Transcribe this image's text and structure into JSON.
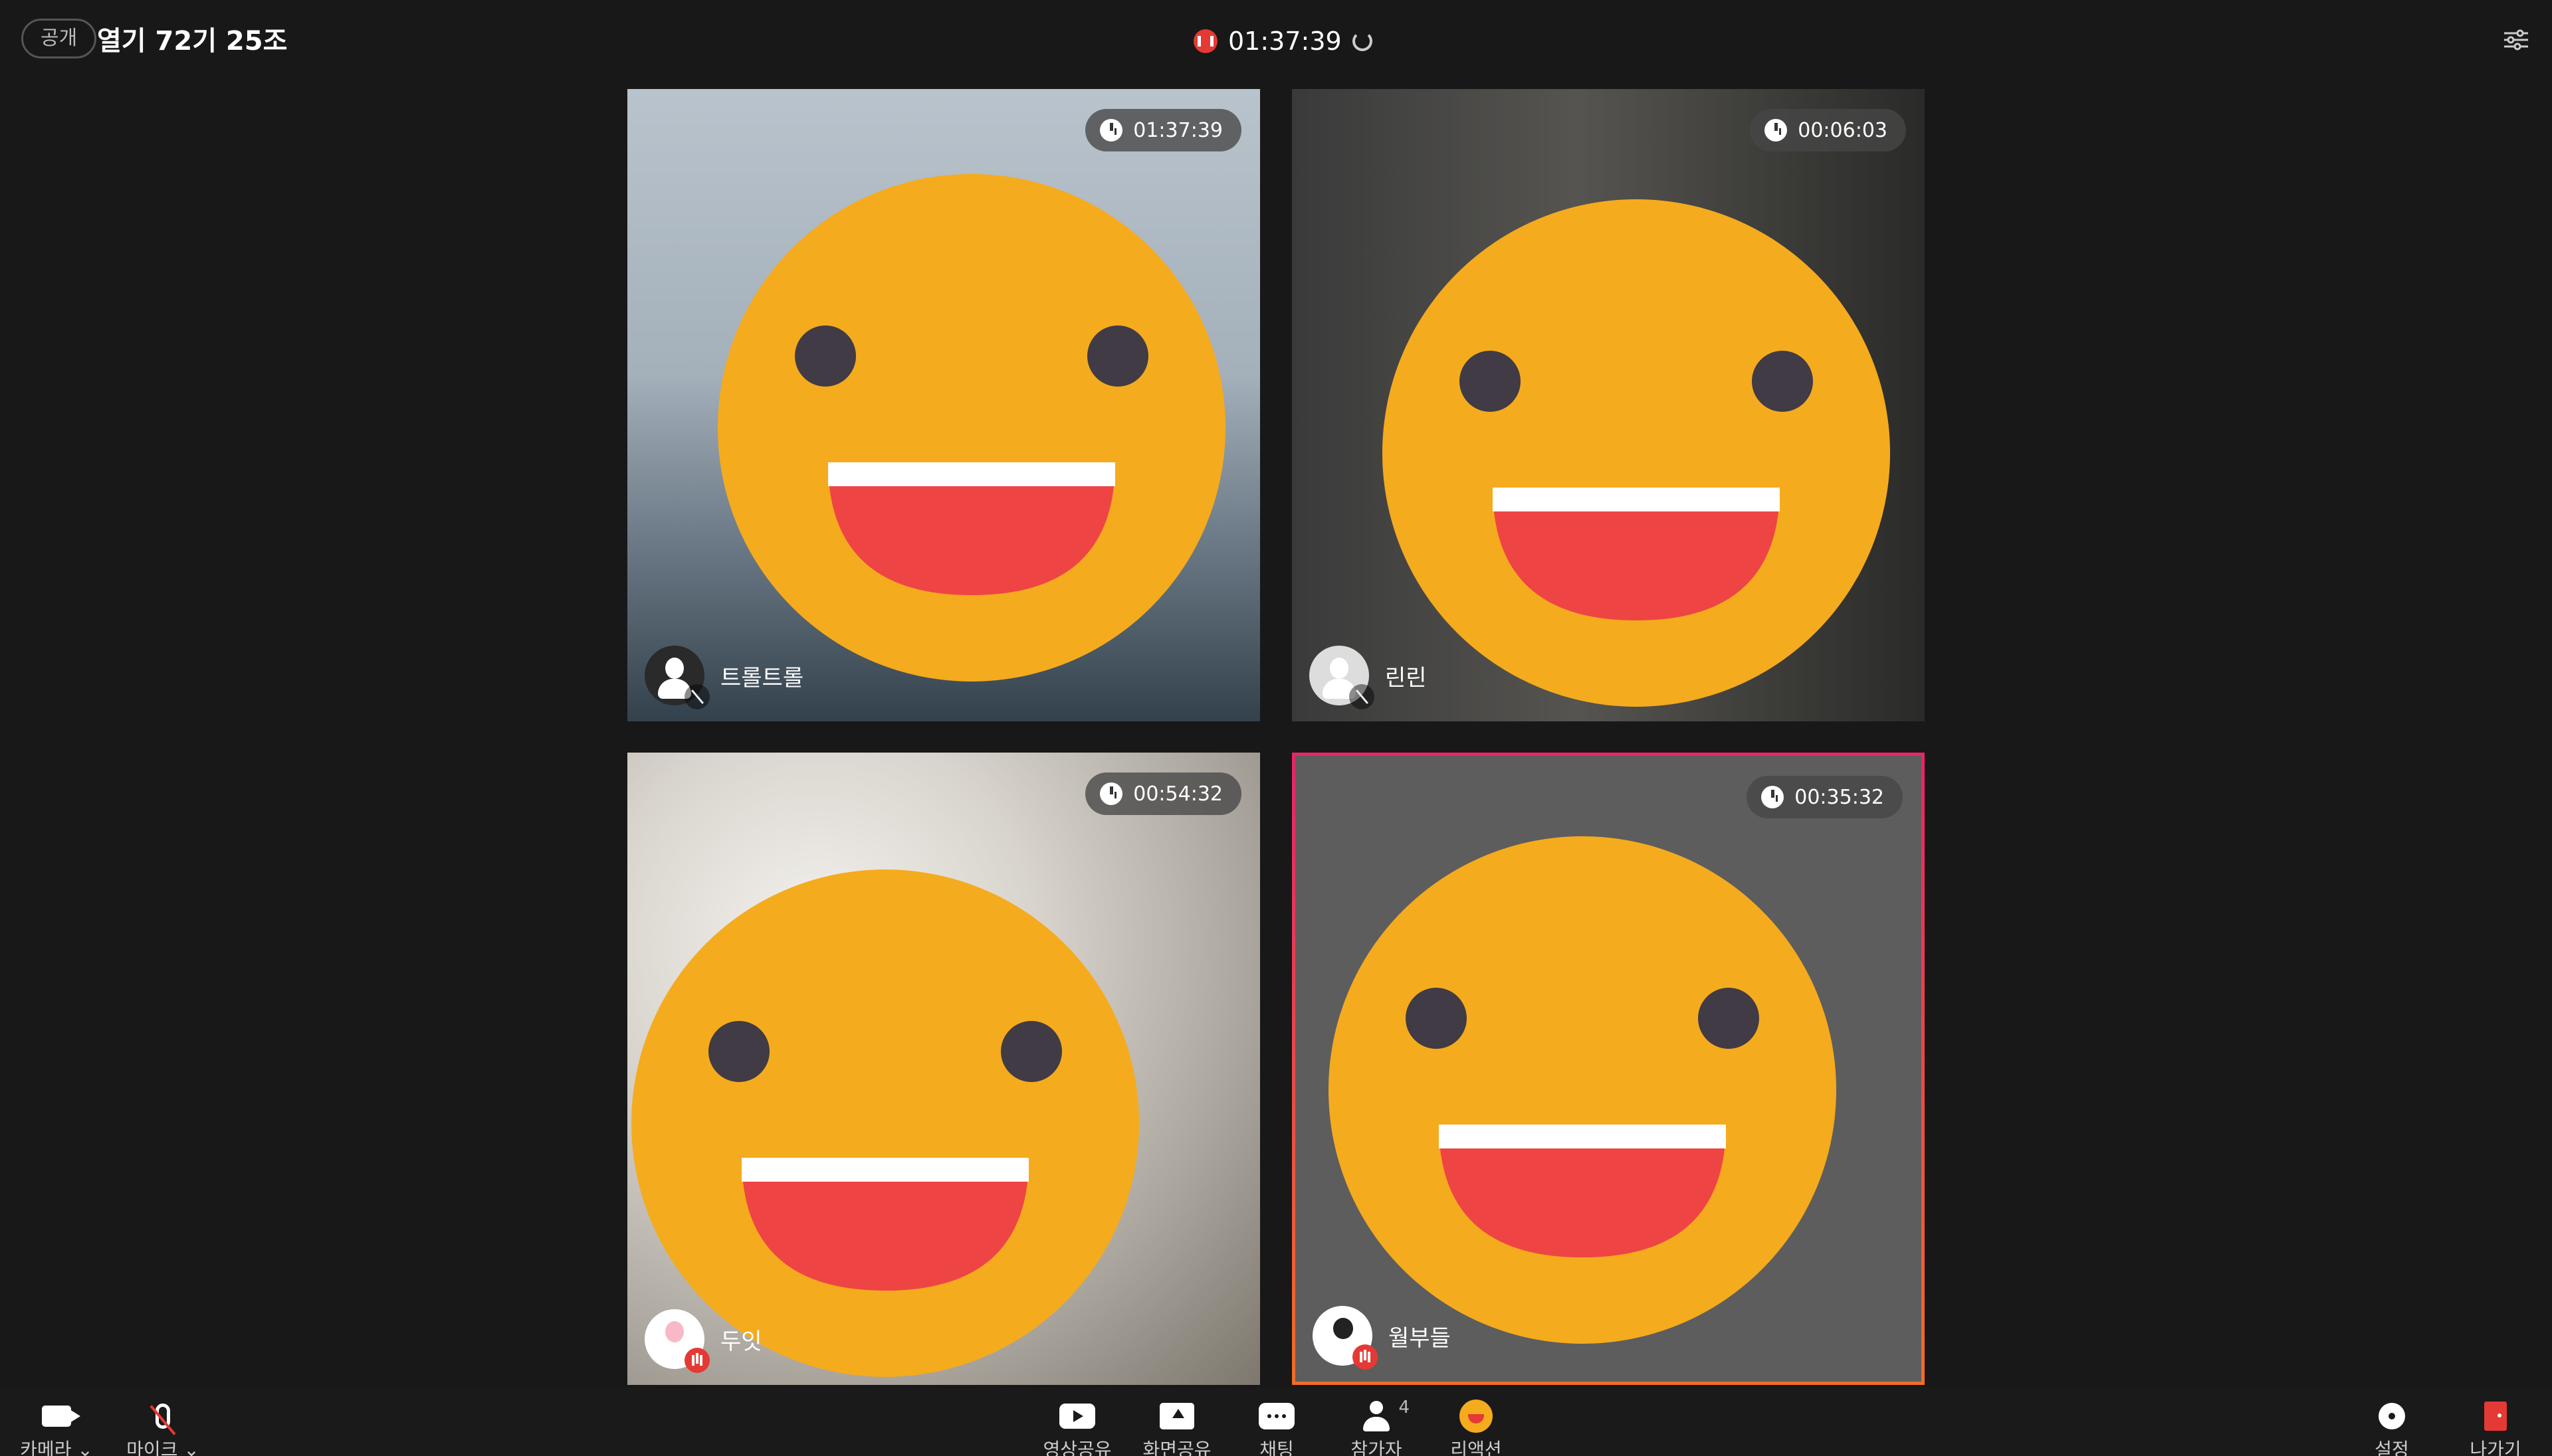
{
  "header": {
    "public_badge": "공개",
    "room_title": "열기 72기 25조",
    "session_timer": "01:37:39"
  },
  "participants": [
    {
      "name": "트롤트롤",
      "timer": "01:37:39",
      "mic": "muted"
    },
    {
      "name": "린린",
      "timer": "00:06:03",
      "mic": "muted"
    },
    {
      "name": "두잇",
      "timer": "00:54:32",
      "mic": "speaking"
    },
    {
      "name": "월부들",
      "timer": "00:35:32",
      "mic": "speaking",
      "active": true
    }
  ],
  "toolbar": {
    "camera": "카메라 ⌄",
    "mic": "마이크 ⌄",
    "video_share": "영상공유",
    "screen_share": "화면공유",
    "chat": "채팅",
    "participants": "참가자",
    "participants_count": "4",
    "reaction": "리액션",
    "settings": "설정",
    "leave": "나가기"
  },
  "colors": {
    "accent_red": "#e53935",
    "active_border_start": "#e8246a",
    "active_border_end": "#f06d28",
    "emoji_face": "#f5ab1e"
  }
}
